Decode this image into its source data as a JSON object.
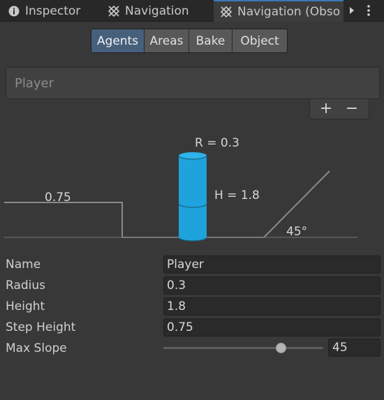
{
  "tabs": [
    {
      "label": "Inspector",
      "icon": "info-icon"
    },
    {
      "label": "Navigation",
      "icon": "navmesh-icon"
    },
    {
      "label": "Navigation (Obso",
      "icon": "navmesh-icon",
      "active": true
    }
  ],
  "toolbar": {
    "buttons": [
      "Agents",
      "Areas",
      "Bake",
      "Object"
    ],
    "selected": "Agents"
  },
  "agents": {
    "items": [
      "Player"
    ],
    "add_label": "+",
    "remove_label": "−"
  },
  "diagram": {
    "radius_label": "R = 0.3",
    "height_label": "H = 1.8",
    "step_label": "0.75",
    "slope_label": "45°"
  },
  "properties": {
    "name": {
      "label": "Name",
      "value": "Player"
    },
    "radius": {
      "label": "Radius",
      "value": "0.3"
    },
    "height": {
      "label": "Height",
      "value": "1.8"
    },
    "step_height": {
      "label": "Step Height",
      "value": "0.75"
    },
    "max_slope": {
      "label": "Max Slope",
      "value": "45",
      "min": 0,
      "max": 60
    }
  },
  "colors": {
    "accent": "#3a79bb",
    "selected_button": "#46607c",
    "agent_cylinder": "#1ea3dc",
    "background": "#383838"
  }
}
